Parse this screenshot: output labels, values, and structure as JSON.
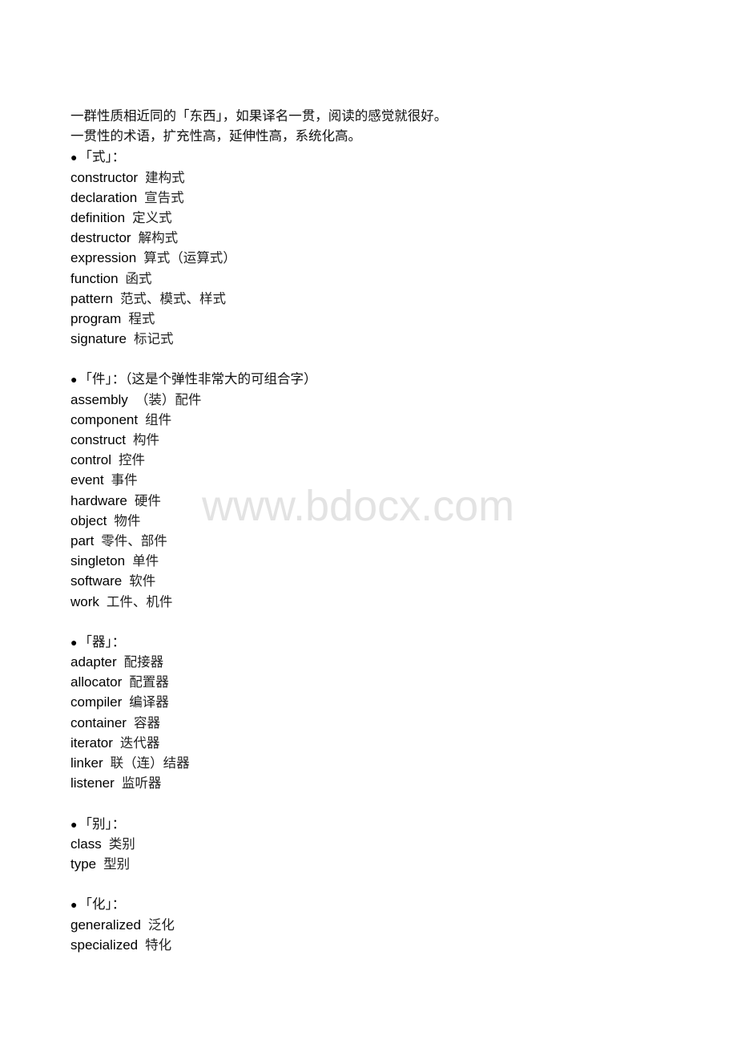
{
  "intro": [
    "一群性质相近同的「东西」，如果译名一贯，阅读的感觉就很好。",
    "一贯性的术语，扩充性高，延伸性高，系统化高。"
  ],
  "bullet_glyph": "●",
  "sections": [
    {
      "heading": "「式」：",
      "terms": [
        {
          "en": "constructor",
          "zh": "建构式"
        },
        {
          "en": "declaration",
          "zh": "宣告式"
        },
        {
          "en": "definition",
          "zh": "定义式"
        },
        {
          "en": "destructor",
          "zh": "解构式"
        },
        {
          "en": "expression",
          "zh": "算式（运算式）"
        },
        {
          "en": "function",
          "zh": "函式"
        },
        {
          "en": "pattern",
          "zh": "范式、模式、样式"
        },
        {
          "en": "program",
          "zh": "程式"
        },
        {
          "en": "signature",
          "zh": "标记式"
        }
      ]
    },
    {
      "heading": "「件」：（这是个弹性非常大的可组合字）",
      "terms": [
        {
          "en": "assembly",
          "zh": "（装）配件"
        },
        {
          "en": "component",
          "zh": "组件"
        },
        {
          "en": "construct",
          "zh": "构件"
        },
        {
          "en": "control",
          "zh": "控件"
        },
        {
          "en": "event",
          "zh": "事件"
        },
        {
          "en": "hardware",
          "zh": "硬件"
        },
        {
          "en": "object",
          "zh": "物件"
        },
        {
          "en": "part",
          "zh": "零件、部件"
        },
        {
          "en": "singleton",
          "zh": "单件"
        },
        {
          "en": "software",
          "zh": "软件"
        },
        {
          "en": "work",
          "zh": "工件、机件"
        }
      ]
    },
    {
      "heading": "「器」：",
      "terms": [
        {
          "en": "adapter",
          "zh": "配接器"
        },
        {
          "en": "allocator",
          "zh": "配置器"
        },
        {
          "en": "compiler",
          "zh": "编译器"
        },
        {
          "en": "container",
          "zh": "容器"
        },
        {
          "en": "iterator",
          "zh": "迭代器"
        },
        {
          "en": "linker",
          "zh": "联（连）结器"
        },
        {
          "en": "listener",
          "zh": "监听器"
        }
      ]
    },
    {
      "heading": "「别」：",
      "terms": [
        {
          "en": "class",
          "zh": "类别"
        },
        {
          "en": "type",
          "zh": "型别"
        }
      ]
    },
    {
      "heading": "「化」：",
      "terms": [
        {
          "en": "generalized",
          "zh": "泛化"
        },
        {
          "en": "specialized",
          "zh": "特化"
        }
      ]
    }
  ],
  "watermark": "www.bdocx.com"
}
